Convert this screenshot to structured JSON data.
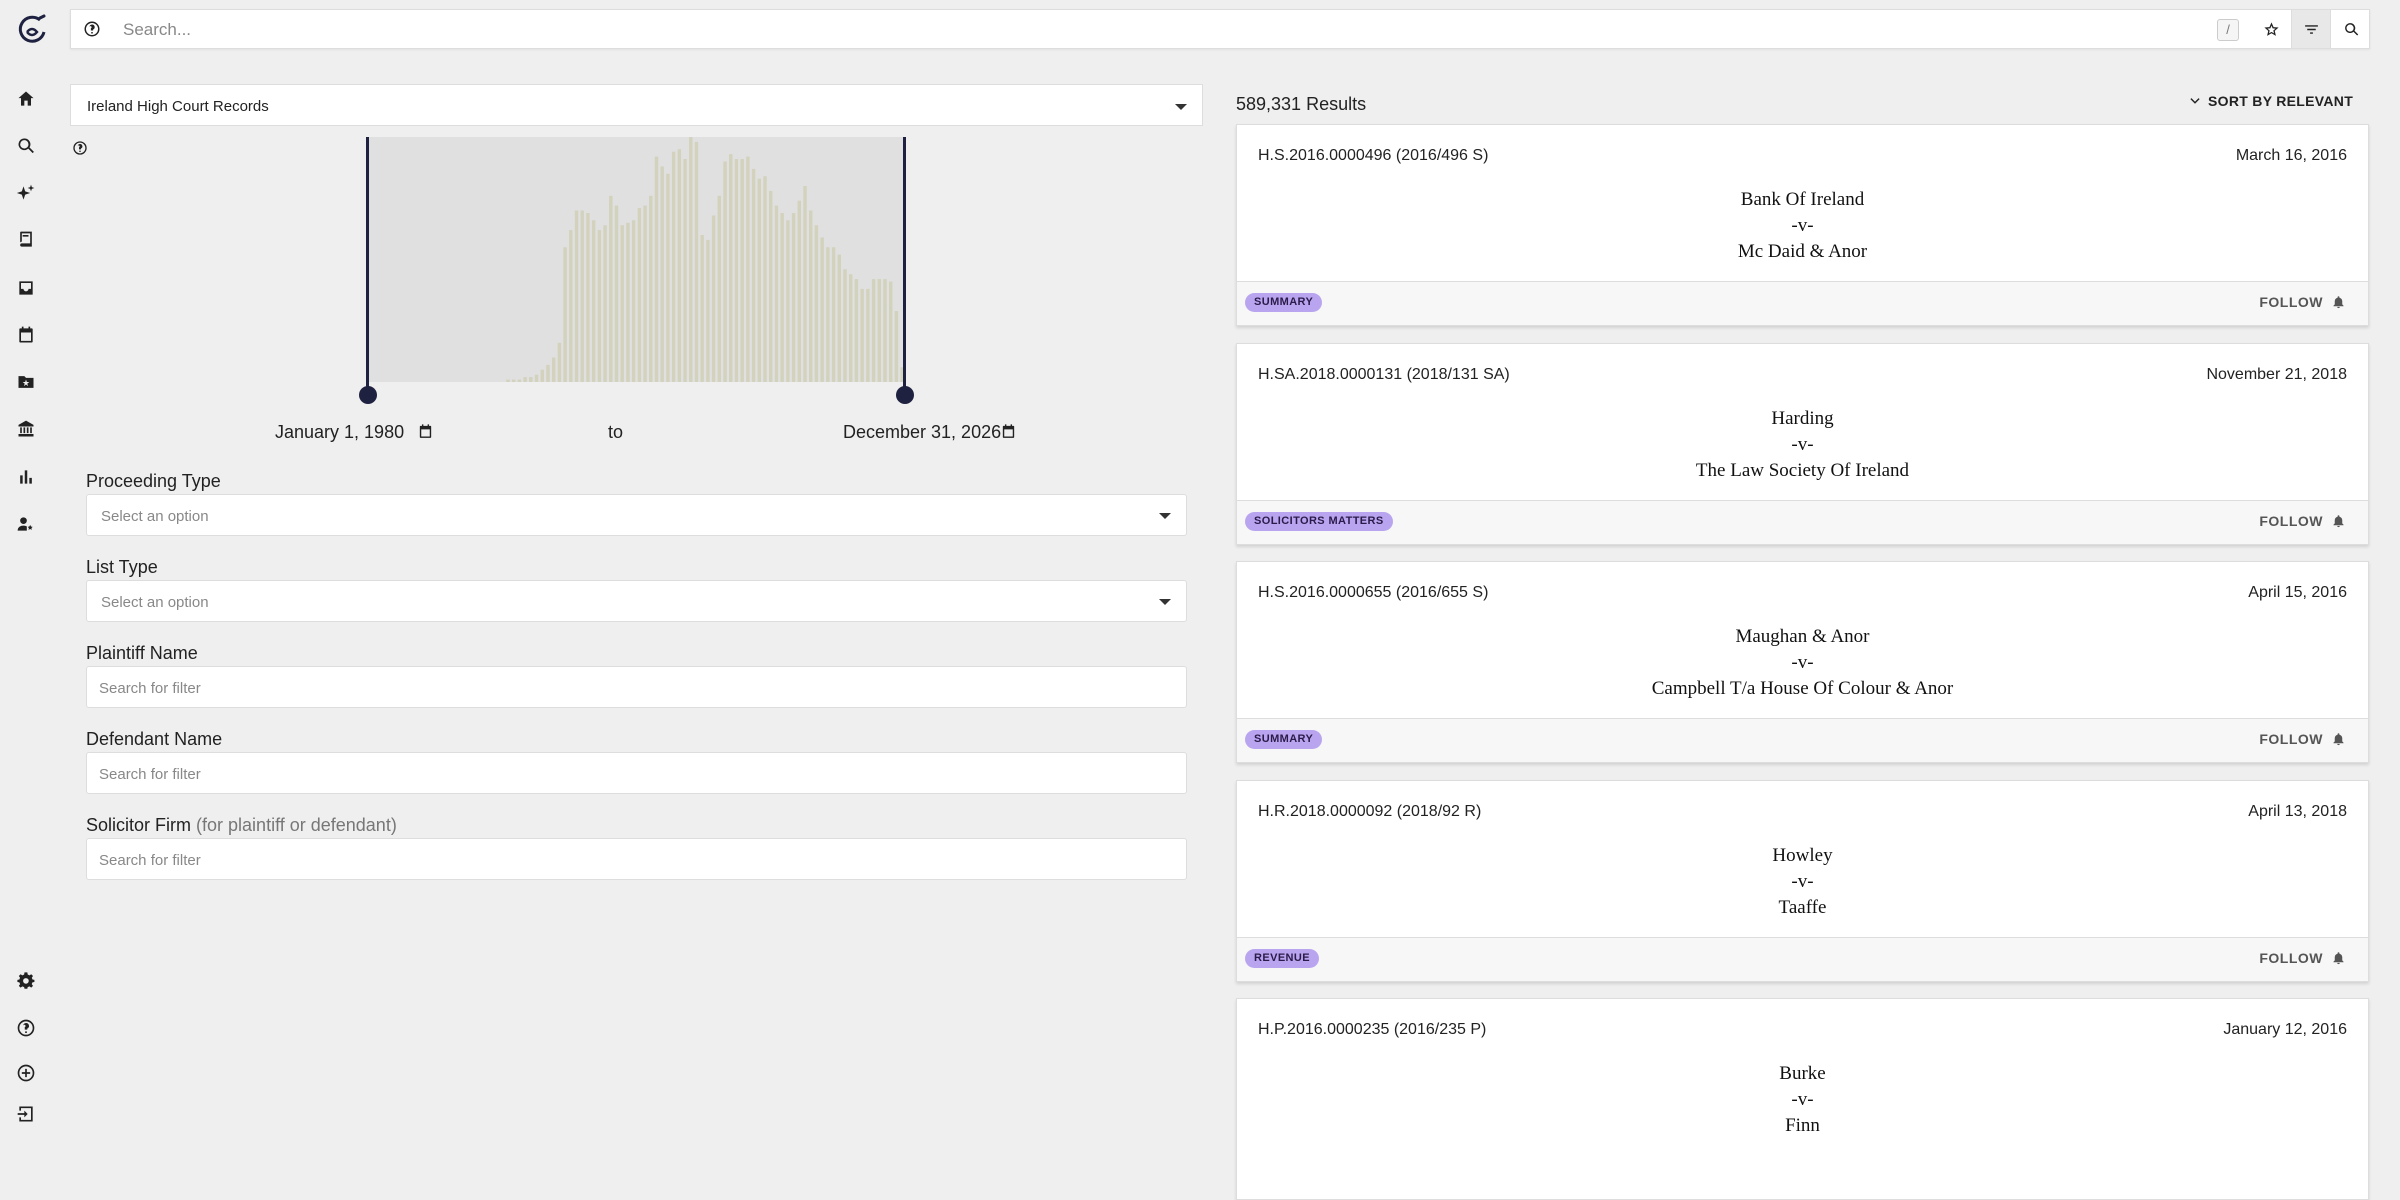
{
  "topbar": {
    "search_placeholder": "Search...",
    "slash_hint": "/"
  },
  "sidebar": {
    "items": [
      "home",
      "search",
      "ai-assistant",
      "library",
      "inbox",
      "calendar",
      "saved-folders",
      "courts",
      "analytics",
      "user-admin"
    ],
    "bottom_items": [
      "settings",
      "help",
      "add",
      "logout"
    ]
  },
  "filters": {
    "court": "Ireland High Court Records",
    "date_from": "January 1, 1980",
    "date_to": "December 31, 2026",
    "to_label": "to",
    "proceeding_type": {
      "label": "Proceeding Type",
      "placeholder": "Select an option"
    },
    "list_type": {
      "label": "List Type",
      "placeholder": "Select an option"
    },
    "plaintiff": {
      "label": "Plaintiff Name",
      "placeholder": "Search for filter"
    },
    "defendant": {
      "label": "Defendant Name",
      "placeholder": "Search for filter"
    },
    "solicitor": {
      "label": "Solicitor Firm",
      "note": "(for plaintiff or defendant)",
      "placeholder": "Search for filter"
    }
  },
  "histogram": {
    "bar_color": "#d3d2bd",
    "relative_heights": [
      0,
      0,
      0,
      0,
      0,
      0,
      0,
      0,
      0,
      0,
      0,
      0,
      0,
      0,
      0,
      0,
      0,
      0,
      0,
      0,
      0,
      0,
      0,
      0,
      0.01,
      0.01,
      0.01,
      0.02,
      0.02,
      0.03,
      0.05,
      0.07,
      0.1,
      0.16,
      0.55,
      0.62,
      0.7,
      0.7,
      0.69,
      0.66,
      0.62,
      0.64,
      0.76,
      0.72,
      0.64,
      0.65,
      0.66,
      0.71,
      0.72,
      0.76,
      0.92,
      0.88,
      0.85,
      0.94,
      0.95,
      0.91,
      1.0,
      0.98,
      0.6,
      0.58,
      0.68,
      0.76,
      0.9,
      0.93,
      0.91,
      0.91,
      0.92,
      0.87,
      0.83,
      0.84,
      0.78,
      0.72,
      0.69,
      0.66,
      0.69,
      0.74,
      0.8,
      0.7,
      0.64,
      0.59,
      0.55,
      0.55,
      0.52,
      0.46,
      0.44,
      0.42,
      0.38,
      0.38,
      0.42,
      0.42,
      0.42,
      0.41,
      0.29,
      0.06
    ]
  },
  "results": {
    "count_label": "589,331 Results",
    "sort_label": "SORT BY RELEVANT",
    "follow_label": "FOLLOW",
    "badge_color": "#b9a5ef",
    "cards": [
      {
        "ref": "H.S.2016.0000496 (2016/496 S)",
        "date": "March 16, 2016",
        "plaintiff": "Bank Of Ireland",
        "vs": "-v-",
        "defendant": "Mc Daid & Anor",
        "badge": "SUMMARY"
      },
      {
        "ref": "H.SA.2018.0000131 (2018/131 SA)",
        "date": "November 21, 2018",
        "plaintiff": "Harding",
        "vs": "-v-",
        "defendant": "The Law Society Of Ireland",
        "badge": "SOLICITORS MATTERS"
      },
      {
        "ref": "H.S.2016.0000655 (2016/655 S)",
        "date": "April 15, 2016",
        "plaintiff": "Maughan & Anor",
        "vs": "-v-",
        "defendant": "Campbell T/a House Of Colour & Anor",
        "badge": "SUMMARY"
      },
      {
        "ref": "H.R.2018.0000092 (2018/92 R)",
        "date": "April 13, 2018",
        "plaintiff": "Howley",
        "vs": "-v-",
        "defendant": "Taaffe",
        "badge": "REVENUE"
      },
      {
        "ref": "H.P.2016.0000235 (2016/235 P)",
        "date": "January 12, 2016",
        "plaintiff": "Burke",
        "vs": "-v-",
        "defendant": "Finn",
        "badge": ""
      }
    ]
  }
}
